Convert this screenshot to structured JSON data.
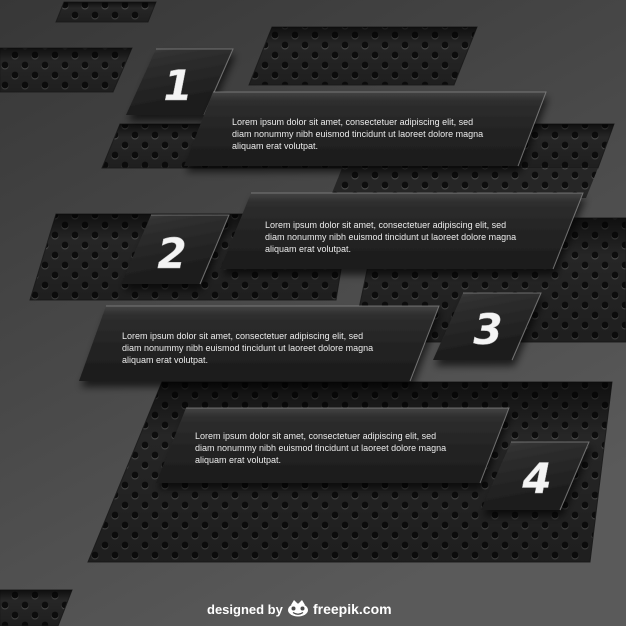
{
  "steps": [
    {
      "number": "1",
      "lines": [
        "Lorem ipsum dolor sit amet, consectetuer adipiscing elit, sed",
        "diam nonummy nibh euismod tincidunt ut laoreet dolore magna",
        "aliquam erat volutpat."
      ]
    },
    {
      "number": "2",
      "lines": [
        "Lorem ipsum dolor sit amet, consectetuer adipiscing elit, sed",
        "diam nonummy nibh euismod tincidunt ut laoreet dolore magna",
        "aliquam erat volutpat."
      ]
    },
    {
      "number": "3",
      "lines": [
        "Lorem ipsum dolor sit amet, consectetuer adipiscing elit, sed",
        "diam nonummy nibh euismod tincidunt ut laoreet dolore magna",
        "aliquam erat volutpat."
      ]
    },
    {
      "number": "4",
      "lines": [
        "Lorem ipsum dolor sit amet, consectetuer adipiscing elit, sed",
        "diam nonummy nibh euismod tincidunt ut laoreet dolore magna",
        "aliquam erat volutpat."
      ]
    }
  ],
  "footer": {
    "designed_by": "designed by",
    "logo_icon": "freepik-logo-icon",
    "brand": "freepik.com"
  },
  "colors": {
    "background": "#4a4a4a",
    "panel": "#232323",
    "perforation": "#0d0d0d",
    "text": "#ececec"
  }
}
